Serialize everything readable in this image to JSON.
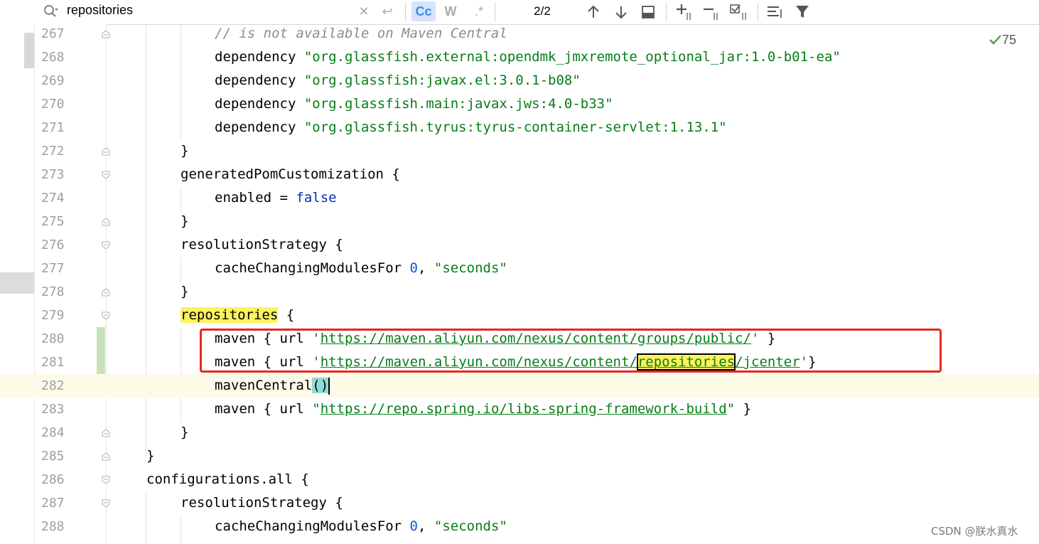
{
  "search": {
    "query": "repositories",
    "match_count": "2/2",
    "case_label": "Cc",
    "word_label": "W",
    "regex_label": ".*"
  },
  "inspection": {
    "count": "75"
  },
  "watermark": "CSDN @朕水真水",
  "lines": [
    {
      "n": "267"
    },
    {
      "n": "268"
    },
    {
      "n": "269"
    },
    {
      "n": "270"
    },
    {
      "n": "271"
    },
    {
      "n": "272"
    },
    {
      "n": "273"
    },
    {
      "n": "274"
    },
    {
      "n": "275"
    },
    {
      "n": "276"
    },
    {
      "n": "277"
    },
    {
      "n": "278"
    },
    {
      "n": "279"
    },
    {
      "n": "280"
    },
    {
      "n": "281"
    },
    {
      "n": "282"
    },
    {
      "n": "283"
    },
    {
      "n": "284"
    },
    {
      "n": "285"
    },
    {
      "n": "286"
    },
    {
      "n": "287"
    },
    {
      "n": "288"
    }
  ],
  "code": {
    "l267": "// is not available on Maven Central",
    "l268_kw": "dependency ",
    "l268_str": "\"org.glassfish.external:opendmk_jmxremote_optional_jar:1.0-b01-ea\"",
    "l269_kw": "dependency ",
    "l269_str": "\"org.glassfish:javax.el:3.0.1-b08\"",
    "l270_kw": "dependency ",
    "l270_str": "\"org.glassfish.main:javax.jws:4.0-b33\"",
    "l271_kw": "dependency ",
    "l271_str": "\"org.glassfish.tyrus:tyrus-container-servlet:1.13.1\"",
    "l272": "}",
    "l273": "generatedPomCustomization {",
    "l274_a": "enabled = ",
    "l274_b": "false",
    "l275": "}",
    "l276": "resolutionStrategy {",
    "l277_a": "cacheChangingModulesFor ",
    "l277_num": "0",
    "l277_c": ", ",
    "l277_str": "\"seconds\"",
    "l278": "}",
    "l279_hl": "repositories",
    "l279_b": " {",
    "l280_a": "maven { url ",
    "l280_q1": "'",
    "l280_url": "https://maven.aliyun.com/nexus/content/groups/public/",
    "l280_q2": "'",
    "l280_b": " }",
    "l281_a": "maven { url ",
    "l281_q1": "'",
    "l281_url1": "https://maven.aliyun.com/nexus/content/",
    "l281_hl": "repositories",
    "l281_url2": "/jcenter",
    "l281_q2": "'",
    "l281_b": "}",
    "l282_a": "mavenCentral",
    "l282_b": "()",
    "l283_a": "maven { url ",
    "l283_q1": "\"",
    "l283_url": "https://repo.spring.io/libs-spring-framework-build",
    "l283_q2": "\"",
    "l283_b": " }",
    "l284": "}",
    "l285": "}",
    "l286": "configurations.all {",
    "l287": "resolutionStrategy {",
    "l288_a": "cacheChangingModulesFor ",
    "l288_num": "0",
    "l288_c": ", ",
    "l288_str": "\"seconds\""
  }
}
